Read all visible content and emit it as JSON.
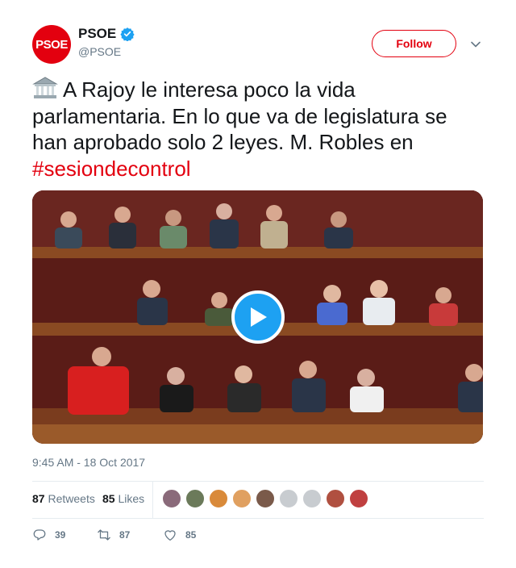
{
  "account": {
    "avatar_text": "PSOE",
    "display_name": "PSOE",
    "handle": "@PSOE",
    "verified": true,
    "brand_color": "#e3000f"
  },
  "follow_label": "Follow",
  "tweet": {
    "emoji": "classical-building-icon",
    "text": "A Rajoy le interesa poco la vida parlamentaria. En lo que va de legislatura se han aprobado solo 2 leyes. M. Robles en ",
    "hashtag": "#sesiondecontrol"
  },
  "media": {
    "type": "video",
    "play_icon": "play-icon"
  },
  "timestamp": "9:45 AM - 18 Oct 2017",
  "stats": {
    "retweets_count": "87",
    "retweets_label": "Retweets",
    "likes_count": "85",
    "likes_label": "Likes"
  },
  "likers": [
    "#8a6a7a",
    "#6b7a5a",
    "#d98a3a",
    "#e0a060",
    "#7a5a4a",
    "#c8ccd0",
    "#c8ccd0",
    "#b05040",
    "#c04040"
  ],
  "actions": {
    "reply_count": "39",
    "retweet_count": "87",
    "like_count": "85"
  },
  "colors": {
    "text": "#14171a",
    "muted": "#657786",
    "link": "#e3000f",
    "play": "#1da1f2"
  }
}
